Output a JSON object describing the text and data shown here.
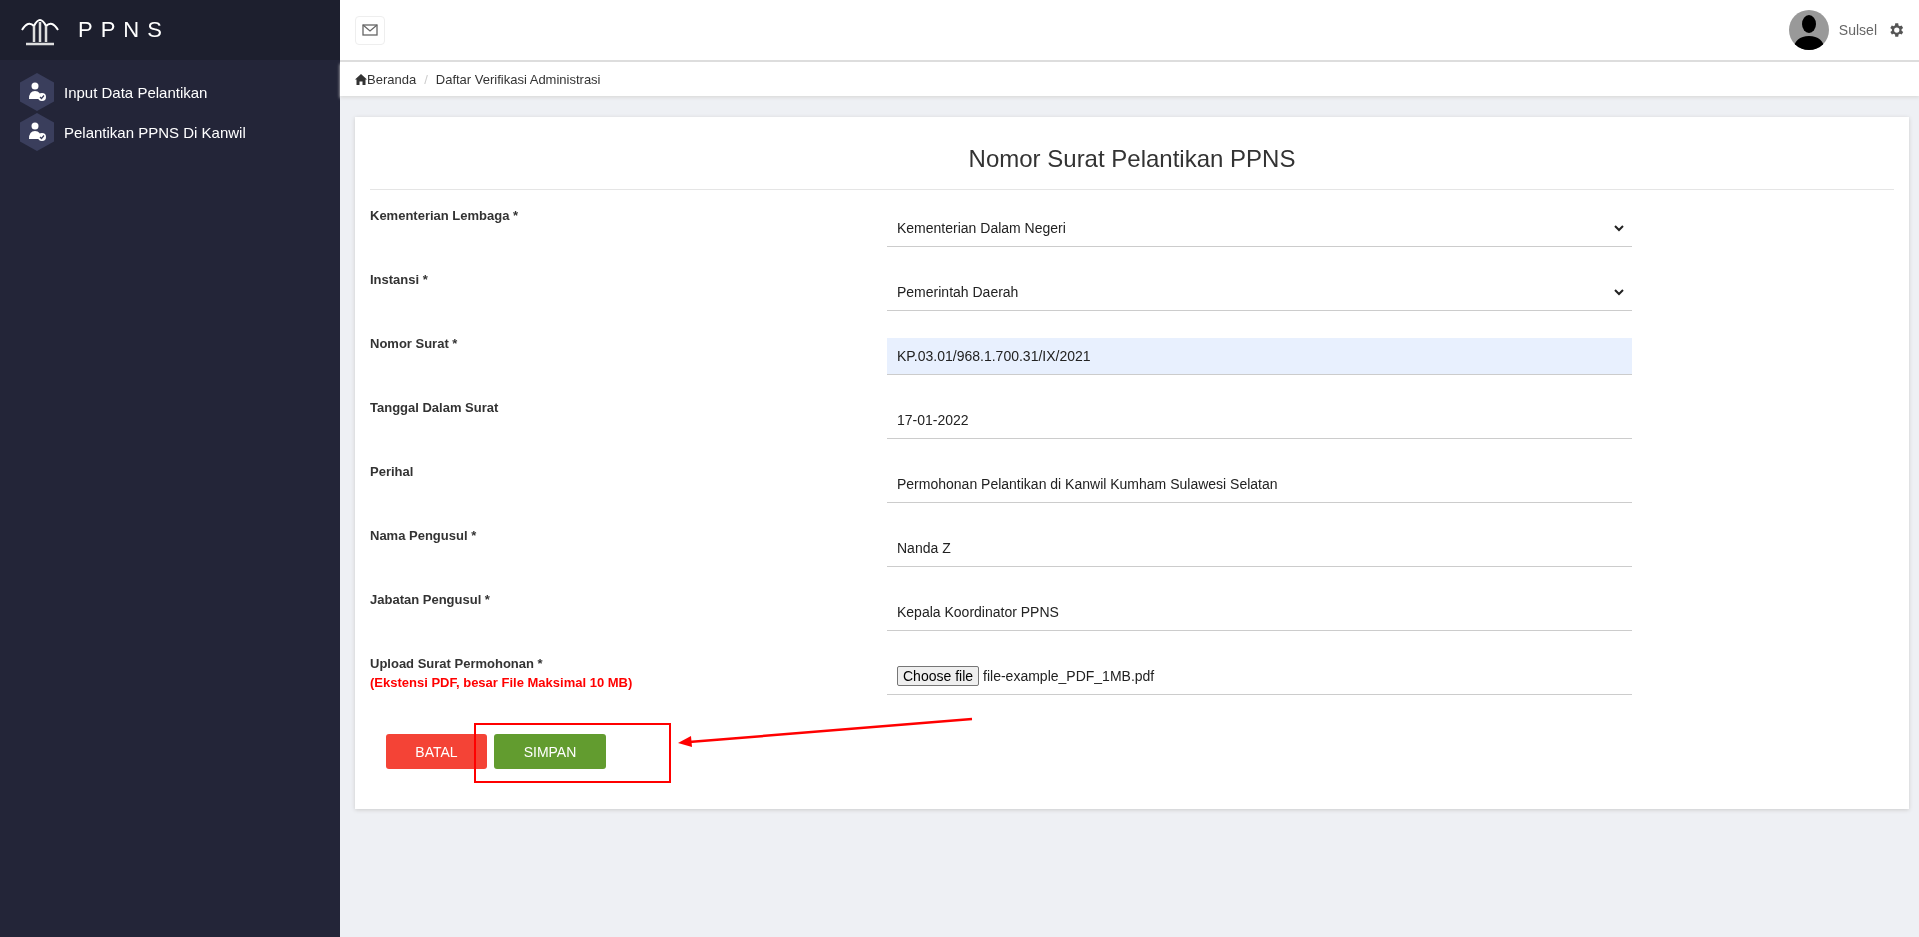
{
  "sidebar": {
    "brand": "PPNS",
    "items": [
      {
        "label": "Input Data Pelantikan"
      },
      {
        "label": "Pelantikan PPNS Di Kanwil"
      }
    ]
  },
  "header": {
    "user": "Sulsel"
  },
  "breadcrumb": {
    "separator": "/",
    "items": [
      {
        "label": "Beranda"
      },
      {
        "label": "Daftar Verifikasi Administrasi"
      }
    ]
  },
  "form": {
    "title": "Nomor Surat Pelantikan PPNS",
    "fields": [
      {
        "kind": "select",
        "label": "Kementerian Lembaga *",
        "value": "Kementerian Dalam Negeri",
        "highlighted": false
      },
      {
        "kind": "select",
        "label": "Instansi *",
        "value": "Pemerintah Daerah",
        "highlighted": false
      },
      {
        "kind": "text",
        "label": "Nomor Surat *",
        "value": "KP.03.01/968.1.700.31/IX/2021",
        "highlighted": true
      },
      {
        "kind": "text",
        "label": "Tanggal Dalam Surat",
        "value": "17-01-2022",
        "highlighted": false
      },
      {
        "kind": "text",
        "label": "Perihal",
        "value": "Permohonan Pelantikan di Kanwil Kumham Sulawesi Selatan",
        "highlighted": false
      },
      {
        "kind": "text",
        "label": "Nama Pengusul *",
        "value": "Nanda Z",
        "highlighted": false
      },
      {
        "kind": "text",
        "label": "Jabatan Pengusul *",
        "value": "Kepala Koordinator PPNS",
        "highlighted": false
      },
      {
        "kind": "file",
        "label": "Upload Surat Permohonan *",
        "hint": "(Ekstensi PDF, besar File Maksimal 10 MB)",
        "button": "Choose file",
        "value": "file-example_PDF_1MB.pdf"
      }
    ],
    "buttons": [
      {
        "kind": "cancel",
        "label": "BATAL"
      },
      {
        "kind": "save",
        "label": "SIMPAN"
      }
    ]
  }
}
